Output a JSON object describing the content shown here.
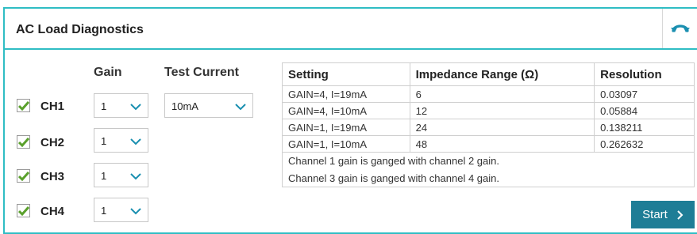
{
  "header": {
    "title": "AC Load Diagnostics",
    "refresh_icon": "refresh-icon"
  },
  "columns": {
    "gain": "Gain",
    "test_current": "Test Current"
  },
  "channels": [
    {
      "label": "CH1",
      "checked": true,
      "gain": "1"
    },
    {
      "label": "CH2",
      "checked": true,
      "gain": "1"
    },
    {
      "label": "CH3",
      "checked": true,
      "gain": "1"
    },
    {
      "label": "CH4",
      "checked": true,
      "gain": "1"
    }
  ],
  "test_current": {
    "value": "10mA"
  },
  "table": {
    "headers": [
      "Setting",
      "Impedance Range (Ω)",
      "Resolution"
    ],
    "rows": [
      [
        "GAIN=4, I=19mA",
        "6",
        "0.03097"
      ],
      [
        "GAIN=4, I=10mA",
        "12",
        "0.05884"
      ],
      [
        "GAIN=1, I=19mA",
        "24",
        "0.138211"
      ],
      [
        "GAIN=1, I=10mA",
        "48",
        "0.262632"
      ]
    ],
    "notes": [
      "Channel 1 gain is ganged with channel 2 gain.",
      "Channel 3 gain is ganged with channel 4 gain."
    ]
  },
  "start_button": {
    "label": "Start"
  },
  "colors": {
    "accent": "#2fbdc4",
    "button": "#1e7d96",
    "check": "#5aa02c"
  }
}
